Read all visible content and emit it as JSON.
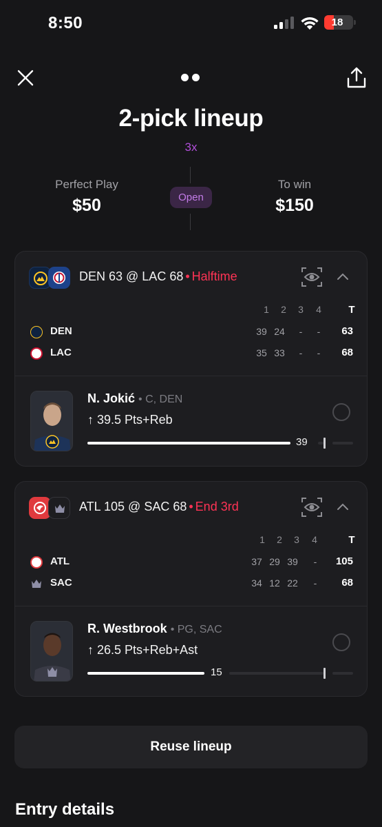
{
  "status_bar": {
    "time": "8:50",
    "battery": "18"
  },
  "header": {
    "title": "2-pick lineup",
    "multiplier": "3x"
  },
  "summary": {
    "left_label": "Perfect Play",
    "left_value": "$50",
    "status": "Open",
    "right_label": "To win",
    "right_value": "$150"
  },
  "games": [
    {
      "matchup": "DEN 63 @ LAC 68",
      "separator": "•",
      "phase": "Halftime",
      "quarters": [
        "1",
        "2",
        "3",
        "4"
      ],
      "total_label": "T",
      "teams": [
        {
          "abbr": "DEN",
          "q": [
            "39",
            "24",
            "-",
            "-"
          ],
          "total": "63",
          "color": "#0e2240"
        },
        {
          "abbr": "LAC",
          "q": [
            "35",
            "33",
            "-",
            "-"
          ],
          "total": "68",
          "color": "#1d428a"
        }
      ],
      "player": {
        "name": "N. Jokić",
        "meta": "• C, DEN",
        "line": "39.5 Pts+Reb",
        "current": "39",
        "progress": 0.98
      }
    },
    {
      "matchup": "ATL 105 @ SAC 68",
      "separator": "•",
      "phase": "End 3rd",
      "quarters": [
        "1",
        "2",
        "3",
        "4"
      ],
      "total_label": "T",
      "teams": [
        {
          "abbr": "ATL",
          "q": [
            "37",
            "29",
            "39",
            "-"
          ],
          "total": "105",
          "color": "#e03a3e"
        },
        {
          "abbr": "SAC",
          "q": [
            "34",
            "12",
            "22",
            "-"
          ],
          "total": "68",
          "color": "#5a2d81"
        }
      ],
      "player": {
        "name": "R. Westbrook",
        "meta": "• PG, SAC",
        "line": "26.5 Pts+Reb+Ast",
        "current": "15",
        "progress": 0.57
      }
    }
  ],
  "actions": {
    "reuse": "Reuse lineup"
  },
  "section": {
    "entry_details": "Entry details"
  },
  "colors": {
    "accent": "#b04fd9",
    "live": "#ff3355",
    "background": "#161618",
    "card": "#1d1d20"
  }
}
